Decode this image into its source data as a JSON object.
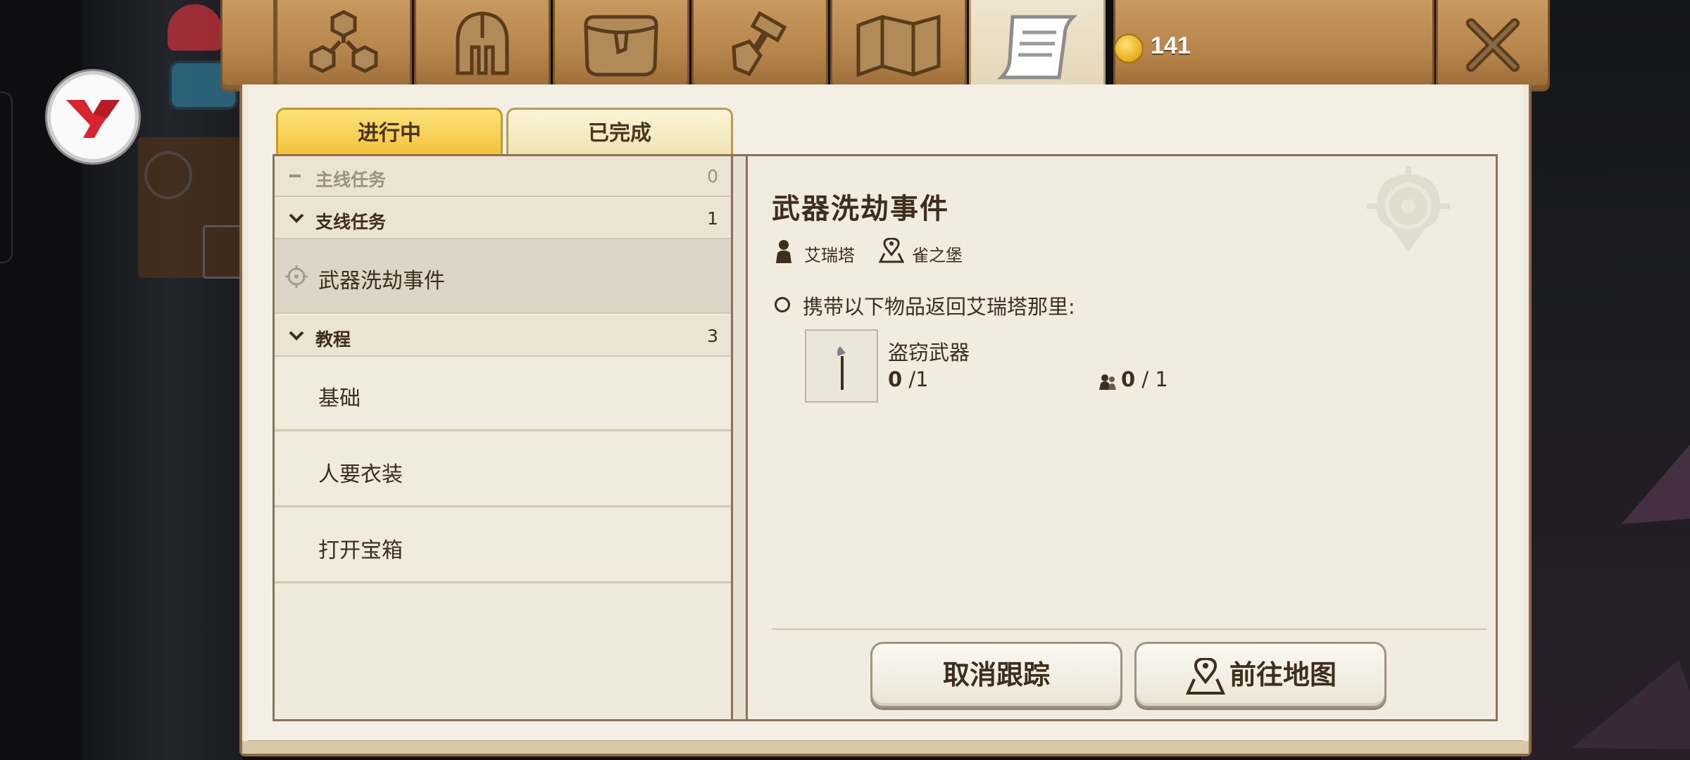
{
  "tabs": [
    {
      "name": "team-tab-icon"
    },
    {
      "name": "helmet-tab-icon"
    },
    {
      "name": "bag-tab-icon"
    },
    {
      "name": "crafting-tab-icon"
    },
    {
      "name": "map-tab-icon"
    },
    {
      "name": "quest-scroll-tab-icon",
      "active": true
    }
  ],
  "currency": {
    "icon": "gold-coin-icon",
    "amount": "141"
  },
  "close_icon": "close-x-icon",
  "subtabs": {
    "in_progress": "进行中",
    "completed": "已完成"
  },
  "quest_list": {
    "categories": [
      {
        "label": "主线任务",
        "count": "0",
        "collapsed": true
      },
      {
        "label": "支线任务",
        "count": "1"
      },
      {
        "label": "教程",
        "count": "3"
      }
    ],
    "side_quests": [
      {
        "label": "武器洗劫事件",
        "selected": true
      }
    ],
    "tutorial_quests": [
      {
        "label": "基础"
      },
      {
        "label": "人要衣装"
      },
      {
        "label": "打开宝箱"
      }
    ]
  },
  "detail": {
    "title": "武器洗劫事件",
    "npc": "艾瑞塔",
    "location": "雀之堡",
    "objective": "携带以下物品返回艾瑞塔那里:",
    "item": {
      "name": "盗窃武器",
      "have": "0",
      "need": "/1",
      "party_have": "0",
      "party_need": " / 1"
    }
  },
  "buttons": {
    "untrack": "取消跟踪",
    "go_map": "前往地图"
  },
  "colors": {
    "wood": "#b5844a",
    "parchment": "#f4efe4",
    "active_tab": "#f3c23a",
    "text": "#3d2e1e",
    "coin": "#e6ac18"
  }
}
